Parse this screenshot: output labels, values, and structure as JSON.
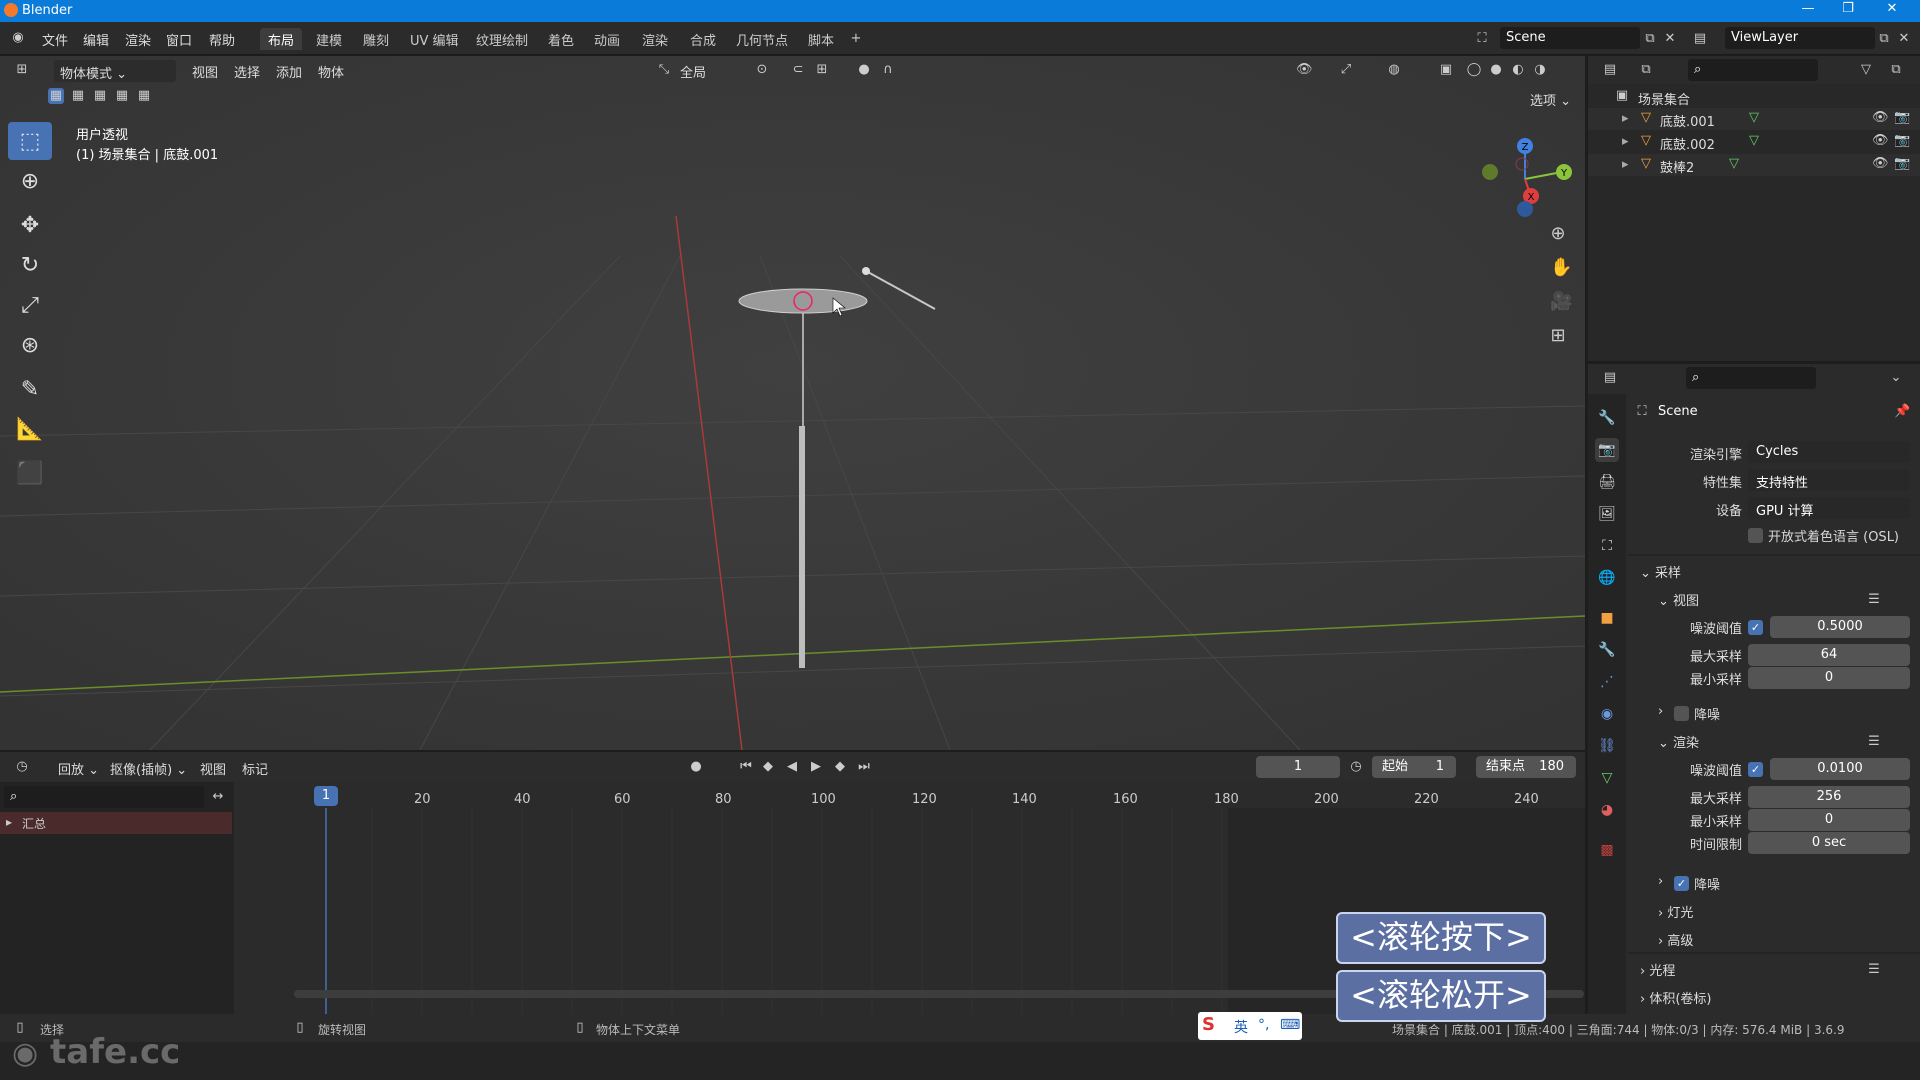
{
  "app": {
    "title": "Blender"
  },
  "menu": [
    "文件",
    "编辑",
    "渲染",
    "窗口",
    "帮助"
  ],
  "workspaces": [
    "布局",
    "建模",
    "雕刻",
    "UV 编辑",
    "纹理绘制",
    "着色",
    "动画",
    "渲染",
    "合成",
    "几何节点",
    "脚本"
  ],
  "active_workspace": "布局",
  "scene_name": "Scene",
  "viewlayer_name": "ViewLayer",
  "viewport": {
    "mode": "物体模式",
    "menus": [
      "视图",
      "选择",
      "添加",
      "物体"
    ],
    "transform_orientation": "全局",
    "options_label": "选项",
    "view_name": "用户透视",
    "context": "(1) 场景集合 | 底鼓.001",
    "axes": {
      "x": "X",
      "y": "Y",
      "z": "Z"
    }
  },
  "outliner": {
    "root": "场景集合",
    "items": [
      {
        "name": "底鼓.001"
      },
      {
        "name": "底鼓.002"
      },
      {
        "name": "鼓棒2"
      }
    ]
  },
  "properties": {
    "context_name": "Scene",
    "render_engine_label": "渲染引擎",
    "render_engine": "Cycles",
    "feature_set_label": "特性集",
    "feature_set": "支持特性",
    "device_label": "设备",
    "device": "GPU 计算",
    "osl_label": "开放式着色语言 (OSL)",
    "sampling": "采样",
    "viewport_section": "视图",
    "vp_noise_label": "噪波阈值",
    "vp_noise": "0.5000",
    "vp_max_label": "最大采样",
    "vp_max": "64",
    "vp_min_label": "最小采样",
    "vp_min": "0",
    "denoise": "降噪",
    "render_section": "渲染",
    "r_noise_label": "噪波阈值",
    "r_noise": "0.0100",
    "r_max_label": "最大采样",
    "r_max": "256",
    "r_min_label": "最小采样",
    "r_min": "0",
    "time_limit_label": "时间限制",
    "time_limit": "0 sec",
    "denoise2": "降噪",
    "lights": "灯光",
    "advanced": "高级",
    "light_paths": "光程",
    "volumes": "体积(卷标)"
  },
  "timeline": {
    "menus": [
      "回放",
      "抠像(插帧)",
      "视图",
      "标记"
    ],
    "current_frame": "1",
    "start_label": "起始",
    "start": "1",
    "end_label": "结束点",
    "end": "180",
    "ruler": [
      "20",
      "40",
      "60",
      "80",
      "100",
      "120",
      "140",
      "160",
      "180",
      "200",
      "220",
      "240"
    ],
    "playhead": "1",
    "summary": "汇总"
  },
  "statusbar": {
    "select": "选择",
    "rotate": "旋转视图",
    "context_menu": "物体上下文菜单",
    "stats": "场景集合 | 底鼓.001 | 顶点:400 | 三角面:744 | 物体:0/3 | 内存: 576.4 MiB | 3.6.9"
  },
  "overlay": {
    "wheel_down": "<滚轮按下>",
    "wheel_up": "<滚轮松开>",
    "watermark": "tafe.cc",
    "ime": "英"
  },
  "colors": {
    "accent": "#4772b3",
    "titlebar": "#0a7bd8",
    "x_axis": "#e03e3e",
    "y_axis": "#8cc43c",
    "z_axis": "#3f82e0"
  }
}
